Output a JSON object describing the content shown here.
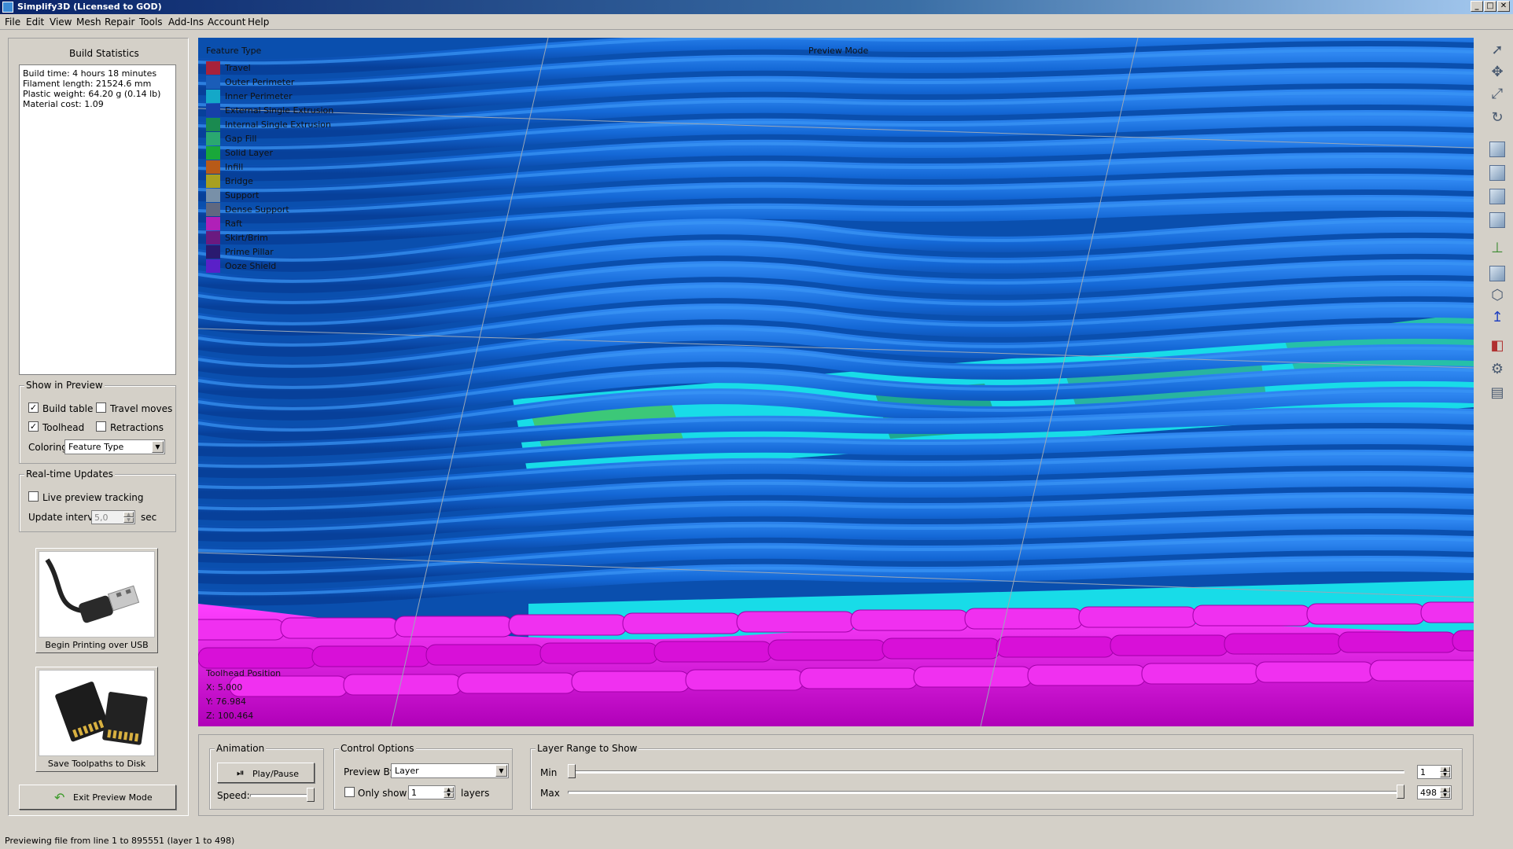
{
  "window": {
    "title": "Simplify3D (Licensed to GOD)",
    "controls": [
      "_",
      "□",
      "✕"
    ]
  },
  "menu": [
    "File",
    "Edit",
    "View",
    "Mesh",
    "Repair",
    "Tools",
    "Add-Ins",
    "Account",
    "Help"
  ],
  "build_statistics": {
    "title": "Build Statistics",
    "lines": [
      "Build time: 4 hours 18 minutes",
      "Filament length: 21524.6 mm",
      "Plastic weight: 64.20 g (0.14 lb)",
      "Material cost: 1.09"
    ]
  },
  "show_in_preview": {
    "title": "Show in Preview",
    "build_table": {
      "label": "Build table",
      "checked": true
    },
    "travel_moves": {
      "label": "Travel moves",
      "checked": false
    },
    "toolhead": {
      "label": "Toolhead",
      "checked": true
    },
    "retractions": {
      "label": "Retractions",
      "checked": false
    },
    "coloring_label": "Coloring",
    "coloring_value": "Feature Type"
  },
  "realtime": {
    "title": "Real-time Updates",
    "live_tracking": {
      "label": "Live preview tracking",
      "checked": false
    },
    "interval_label": "Update interval",
    "interval_value": "5,0",
    "interval_unit": "sec"
  },
  "usb_button": {
    "label": "Begin Printing over USB"
  },
  "sd_button": {
    "label": "Save Toolpaths to Disk"
  },
  "exit_button": {
    "label": "Exit Preview Mode"
  },
  "viewport": {
    "mode_label": "Preview Mode",
    "legend_title": "Feature Type",
    "legend": [
      {
        "label": "Travel",
        "color": "#a8223a"
      },
      {
        "label": "Outer Perimeter",
        "color": "#1a5db8"
      },
      {
        "label": "Inner Perimeter",
        "color": "#14a8c8"
      },
      {
        "label": "External Single Extrusion",
        "color": "#1640a8"
      },
      {
        "label": "Internal Single Extrusion",
        "color": "#1a8a50"
      },
      {
        "label": "Gap Fill",
        "color": "#2aa870"
      },
      {
        "label": "Solid Layer",
        "color": "#19a83a"
      },
      {
        "label": "Infill",
        "color": "#b85a18"
      },
      {
        "label": "Bridge",
        "color": "#a8a020"
      },
      {
        "label": "Support",
        "color": "#7890a8"
      },
      {
        "label": "Dense Support",
        "color": "#606880"
      },
      {
        "label": "Raft",
        "color": "#b020b8"
      },
      {
        "label": "Skirt/Brim",
        "color": "#6a1a80"
      },
      {
        "label": "Prime Pillar",
        "color": "#2a1a70"
      },
      {
        "label": "Ooze Shield",
        "color": "#5a20c8"
      }
    ],
    "toolhead_title": "Toolhead Position",
    "toolhead_x": "X: 5.000",
    "toolhead_y": "Y: 76.984",
    "toolhead_z": "Z: 100.464"
  },
  "right_toolbar": [
    "cursor-icon",
    "move-icon",
    "scale-icon",
    "rotate-icon",
    "view-default-icon",
    "view-front-icon",
    "view-top-icon",
    "view-side-icon",
    "axes-icon",
    "shaded-cube-icon",
    "wireframe-cube-icon",
    "z-axis-icon",
    "section-icon",
    "settings-icon",
    "layers-icon"
  ],
  "animation": {
    "title": "Animation",
    "play_label": "Play/Pause",
    "speed_label": "Speed:"
  },
  "control_options": {
    "title": "Control Options",
    "preview_by_label": "Preview By",
    "preview_by_value": "Layer",
    "only_show_label": "Only show",
    "only_show_checked": false,
    "only_show_value": "1",
    "layers_label": "layers"
  },
  "layer_range": {
    "title": "Layer Range to Show",
    "min_label": "Min",
    "max_label": "Max",
    "min_value": "1",
    "max_value": "498"
  },
  "status": "Previewing file from line 1 to 895551 (layer 1 to 498)",
  "accent_colors": {
    "perimeter_blue": "#0d5fc4",
    "raft_magenta": "#e010e0",
    "inner_cyan": "#18e8e8",
    "solid_green": "#40c870"
  }
}
